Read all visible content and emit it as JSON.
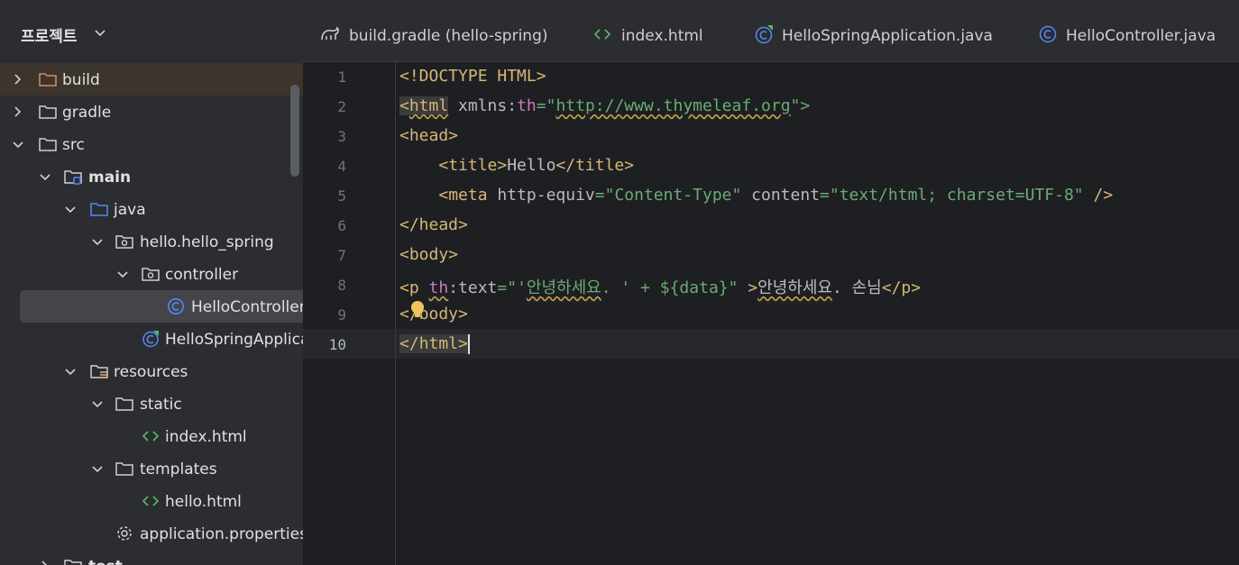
{
  "panel": {
    "title": "프로젝트"
  },
  "tree": [
    {
      "label": "build",
      "icon": "folder-orange-icon"
    },
    {
      "label": "gradle",
      "icon": "folder-icon"
    },
    {
      "label": "src",
      "icon": "folder-icon"
    },
    {
      "label": "main",
      "icon": "source-folder-icon"
    },
    {
      "label": "java",
      "icon": "java-folder-icon"
    },
    {
      "label": "hello.hello_spring",
      "icon": "package-icon"
    },
    {
      "label": "controller",
      "icon": "package-icon"
    },
    {
      "label": "HelloController",
      "icon": "class-icon"
    },
    {
      "label": "HelloSpringApplica",
      "icon": "spring-class-icon"
    },
    {
      "label": "resources",
      "icon": "resources-folder-icon"
    },
    {
      "label": "static",
      "icon": "folder-icon"
    },
    {
      "label": "index.html",
      "icon": "html-file-icon"
    },
    {
      "label": "templates",
      "icon": "folder-icon"
    },
    {
      "label": "hello.html",
      "icon": "html-file-icon"
    },
    {
      "label": "application.properties",
      "icon": "gear-icon"
    },
    {
      "label": "test",
      "icon": "folder-icon"
    }
  ],
  "tabs": [
    {
      "label": "build.gradle (hello-spring)",
      "icon": "gradle-icon"
    },
    {
      "label": "index.html",
      "icon": "html-file-icon"
    },
    {
      "label": "HelloSpringApplication.java",
      "icon": "spring-class-icon"
    },
    {
      "label": "HelloController.java",
      "icon": "class-icon"
    }
  ],
  "editor": {
    "line_numbers": [
      "1",
      "2",
      "3",
      "4",
      "5",
      "6",
      "7",
      "8",
      "9",
      "10"
    ],
    "current_line": "10",
    "l1": {
      "tag": "<!DOCTYPE HTML>"
    },
    "l2": {
      "open": "<",
      "name": "html",
      "sp": " ",
      "attr": "xmlns:",
      "ns": "th",
      "eq": "=\"",
      "url": "http://www.thymeleaf.org",
      "close": "\">"
    },
    "l3": {
      "tag": "<head>"
    },
    "l4": {
      "indent": "    ",
      "open": "<title>",
      "text": "Hello",
      "close": "</title>"
    },
    "l5": {
      "indent": "    ",
      "open": "<meta ",
      "attr1": "http-equiv",
      "eq1": "=",
      "val1": "\"Content-Type\"",
      "sp": " ",
      "attr2": "content",
      "eq2": "=",
      "val2": "\"text/html; charset=UTF-8\"",
      "close": " />"
    },
    "l6": {
      "tag": "</head>"
    },
    "l7": {
      "tag": "<body>"
    },
    "l8": {
      "open": "<p ",
      "ns": "th",
      "attr": ":text",
      "eq": "=",
      "q": "\"'",
      "ko": "안녕하세요",
      "rest": ". ' + ${data}\"",
      "gt": " >",
      "text_ko": "안녕하세요",
      "text_rest": ". 손님",
      "close": "</p>"
    },
    "l9": {
      "tag": "</body>"
    },
    "l10": {
      "open": "</",
      "name": "html",
      "close": ">"
    }
  }
}
